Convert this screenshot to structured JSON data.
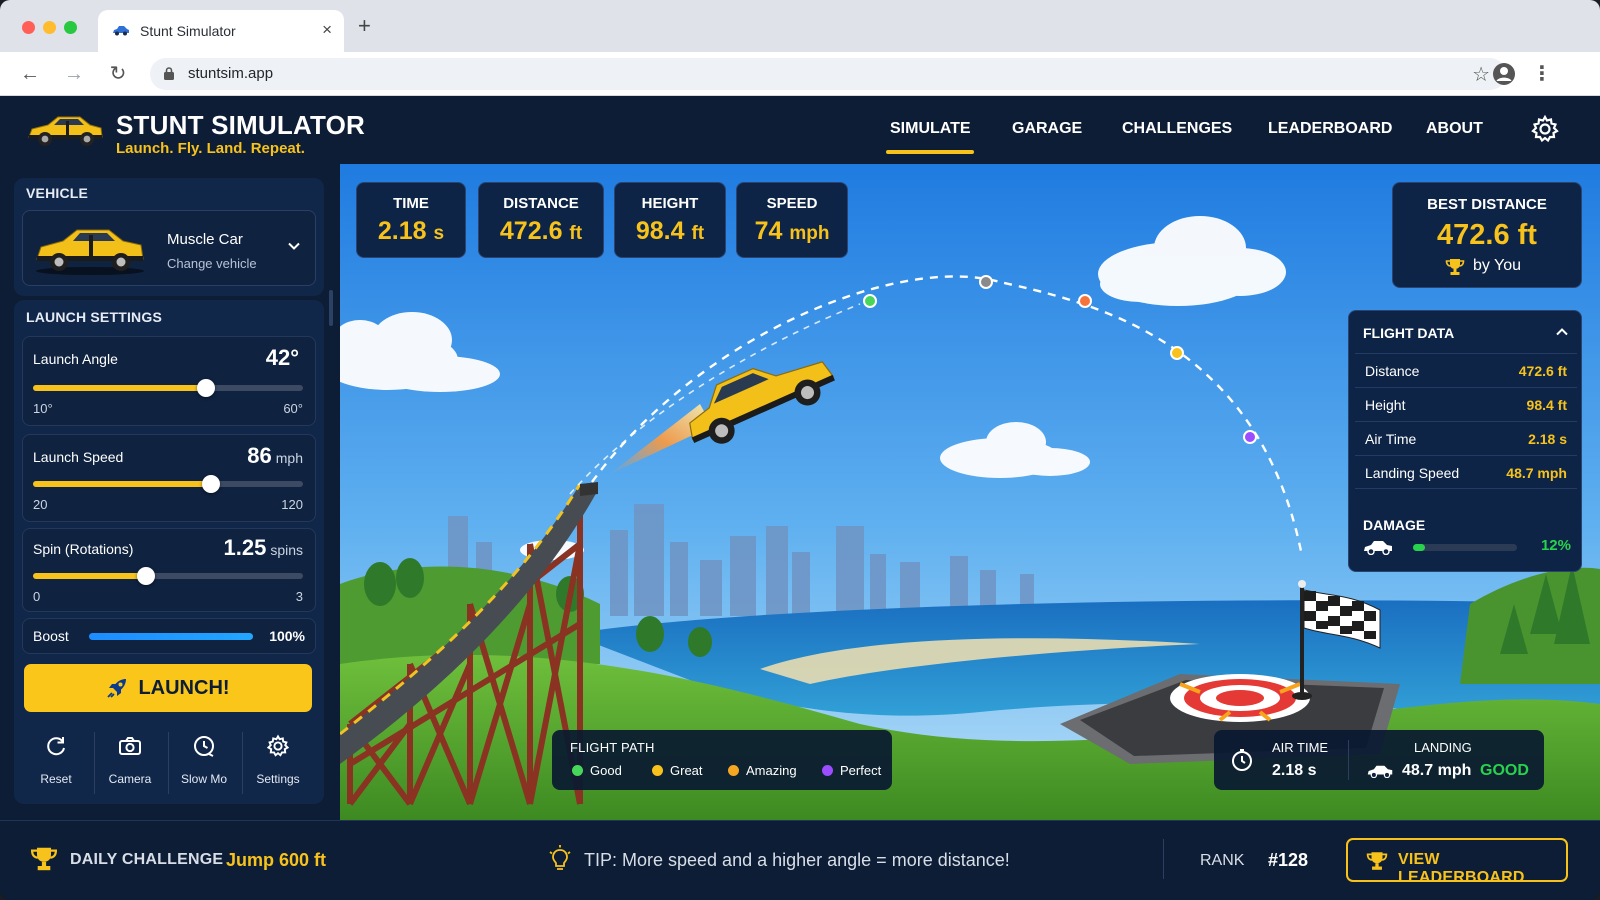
{
  "browser": {
    "tab_title": "Stunt Simulator",
    "tab_close": "×",
    "new_tab": "+",
    "url": "stuntsim.app"
  },
  "header": {
    "title": "STUNT SIMULATOR",
    "subtitle": "Launch. Fly. Land. Repeat.",
    "nav": [
      {
        "label": "SIMULATE",
        "active": true
      },
      {
        "label": "GARAGE",
        "active": false
      },
      {
        "label": "CHALLENGES",
        "active": false
      },
      {
        "label": "LEADERBOARD",
        "active": false
      },
      {
        "label": "ABOUT",
        "active": false
      }
    ],
    "settings_icon": "gear-icon"
  },
  "sidebar": {
    "vehicle_heading": "VEHICLE",
    "vehicle": {
      "name": "Muscle Car",
      "action": "Change vehicle"
    },
    "launch_heading": "LAUNCH SETTINGS",
    "sliders": [
      {
        "label": "Launch Angle",
        "value": "42°",
        "unit": "",
        "min": "10°",
        "max": "60°",
        "min_num": 10,
        "max_num": 60,
        "num": 42
      },
      {
        "label": "Launch Speed",
        "value": "86",
        "unit": "mph",
        "min": "20",
        "max": "120",
        "min_num": 20,
        "max_num": 120,
        "num": 86
      },
      {
        "label": "Spin (Rotations)",
        "value": "1.25",
        "unit": "spins",
        "min": "0",
        "max": "3",
        "min_num": 0,
        "max_num": 3,
        "num": 1.25
      }
    ],
    "boost": {
      "label": "Boost",
      "value": "100%",
      "fraction": 1.0
    },
    "launch_button": "LAUNCH!",
    "tools": [
      {
        "label": "Reset",
        "icon": "reset-icon"
      },
      {
        "label": "Camera",
        "icon": "camera-icon"
      },
      {
        "label": "Slow Mo",
        "icon": "slow-mo-icon"
      },
      {
        "label": "Settings",
        "icon": "gear-icon"
      }
    ]
  },
  "stats": [
    {
      "label": "TIME",
      "value": "2.18",
      "unit": "s"
    },
    {
      "label": "DISTANCE",
      "value": "472.6",
      "unit": "ft"
    },
    {
      "label": "HEIGHT",
      "value": "98.4",
      "unit": "ft"
    },
    {
      "label": "SPEED",
      "value": "74",
      "unit": "mph"
    }
  ],
  "best": {
    "label": "BEST DISTANCE",
    "value": "472.6 ft",
    "by": "by You"
  },
  "flight_data": {
    "heading": "FLIGHT DATA",
    "rows": [
      {
        "k": "Distance",
        "v": "472.6 ft"
      },
      {
        "k": "Height",
        "v": "98.4 ft"
      },
      {
        "k": "Air Time",
        "v": "2.18 s"
      },
      {
        "k": "Landing Speed",
        "v": "48.7 mph"
      }
    ],
    "damage_heading": "DAMAGE",
    "damage_value": "12%",
    "damage_fraction": 0.12
  },
  "flight_path_legend": {
    "heading": "FLIGHT PATH",
    "items": [
      {
        "label": "Good",
        "color": "#47d65a"
      },
      {
        "label": "Great",
        "color": "#f7c21b"
      },
      {
        "label": "Amazing",
        "color": "#f5a623"
      },
      {
        "label": "Perfect",
        "color": "#9b4dff"
      }
    ]
  },
  "landing": {
    "air_time_label": "AIR TIME",
    "air_time_value": "2.18 s",
    "landing_label": "LANDING",
    "landing_speed": "48.7 mph",
    "landing_grade": "GOOD"
  },
  "footer": {
    "daily_label": "DAILY CHALLENGE",
    "daily_value": "Jump 600 ft",
    "tip": "TIP: More speed and a higher angle = more distance!",
    "rank_label": "RANK",
    "rank_value": "#128",
    "leaderboard_button": "VIEW LEADERBOARD"
  },
  "colors": {
    "accent": "#f7c21b",
    "navy": "#0d1d35",
    "success": "#28d24d"
  }
}
